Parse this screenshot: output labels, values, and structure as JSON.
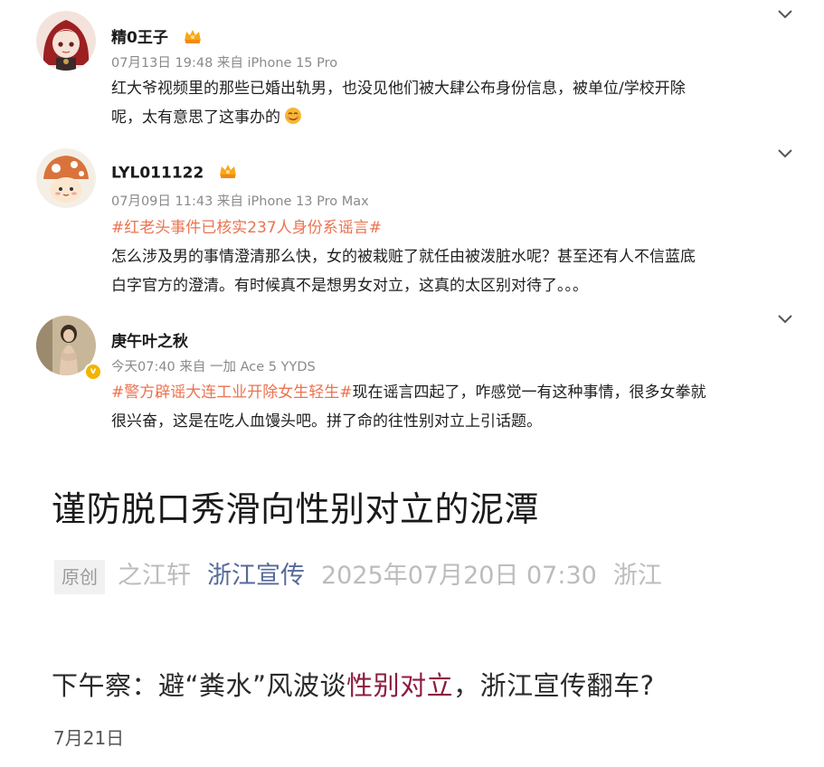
{
  "comments": [
    {
      "username": "精0王子",
      "meta": "07月13日 19:48 来自 iPhone 15 Pro",
      "lines": [
        "红大爷视频里的那些已婚出轨男，也没见他们被大肆公布身份信息，被单位/学校开除",
        "呢，太有意思了这事办的"
      ],
      "emoji": "smirk-emoji",
      "badge": "vip-crown-badge"
    },
    {
      "username": "LYL011122",
      "meta": "07月09日 11:43 来自 iPhone 13 Pro Max",
      "hashtag": "#红老头事件已核实237人身份系谣言#",
      "lines": [
        "怎么涉及男的事情澄清那么快，女的被栽赃了就任由被泼脏水呢？甚至还有人不信蓝底",
        "白字官方的澄清。有时候真不是想男女对立，这真的太区别对待了。。。"
      ],
      "badge": "vip-crown-badge"
    },
    {
      "username": "庚午叶之秋",
      "meta": "今天07:40 来自 一加 Ace 5 YYDS",
      "hashtag": "#警方辟谣大连工业开除女生轻生#",
      "line1_rest": "现在谣言四起了，咋感觉一有这种事情，很多女拳就",
      "line2": "很兴奋，这是在吃人血馒头吧。拼了命的往性别对立上引话题。",
      "verified": "v"
    }
  ],
  "article": {
    "title": "谨防脱口秀滑向性别对立的泥潭",
    "original_label": "原创",
    "author": "之江轩",
    "account": "浙江宣传",
    "date": "2025年07月20日 07:30",
    "location": "浙江"
  },
  "headline": {
    "part1": "下午察：避“粪水”风波谈",
    "highlight": "性别对立",
    "part2": "，浙江宣传翻车?",
    "date": "7月21日"
  },
  "colors": {
    "hashtag": "#eb7350",
    "account_link": "#566a98",
    "headline_highlight": "#8c1c3f",
    "meta_gray": "#8a8a8a"
  }
}
